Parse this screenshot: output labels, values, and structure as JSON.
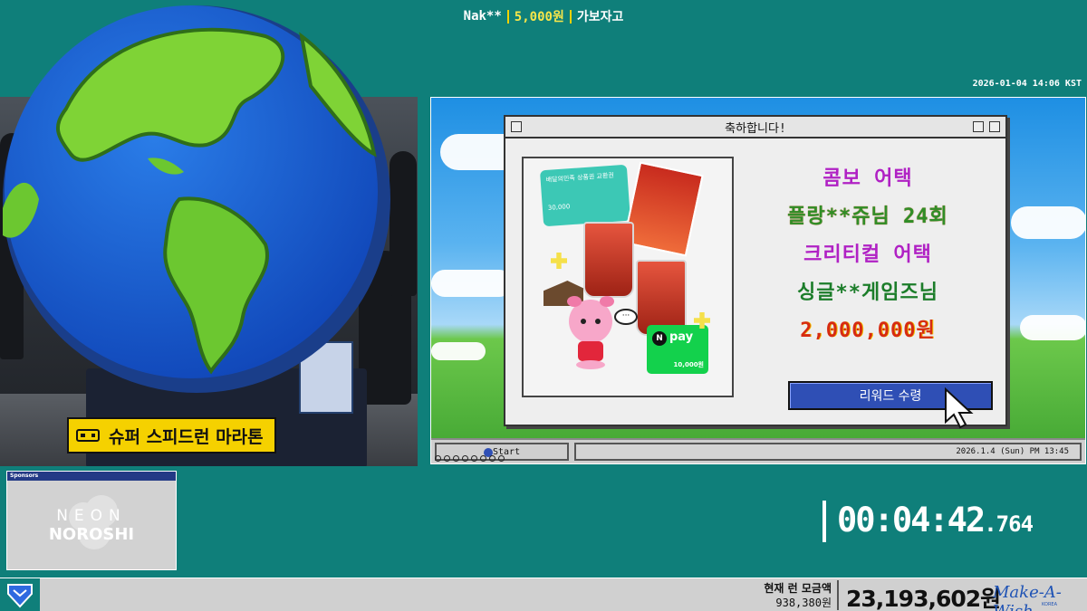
{
  "overlay": {
    "donation": {
      "user": "Nak**",
      "amount": "5,000원",
      "message": "가보자고"
    },
    "datetime": "2026-01-04 14:06 KST",
    "camera_badge": "슈퍼 스피드런 마라톤",
    "timer": {
      "main": "00:04:42",
      "ms": ".764"
    },
    "sponsor": {
      "title": "Sponsors",
      "line1": "NEON",
      "line2": "NOROSHI"
    },
    "bottom": {
      "current_run_label": "현재 런 모금액",
      "current_run_value": "938,380원",
      "total": "23,193,602원",
      "charity": "Make-A-Wish",
      "charity_sub": "KOREA"
    }
  },
  "window": {
    "title": "축하합니다!",
    "lines": [
      "콤보 어택",
      "플랑**쥬님 24회",
      "크리티컬 어택",
      "싱글**게임즈님",
      "2,000,000원"
    ],
    "button": "리워드 수령",
    "gift_card_text": "배달의민족 상품권 교환권",
    "gift_card_value": "30,000",
    "npay_label": "pay",
    "npay_value": "10,000원"
  },
  "taskbar": {
    "start": "Start",
    "clock": "2026.1.4 (Sun) PM 13:45"
  },
  "colors": {
    "background": "#0f7f7a",
    "badge": "#f5d100",
    "reward_button": "#2f4fb5",
    "magenta_text": "#b021c4",
    "green_text": "#2f8e27",
    "prize_text": "#d62b12"
  },
  "icons": [
    "globe-icon",
    "gamepad-icon",
    "cursor-icon",
    "start-orb-icon",
    "shield-logo-icon",
    "cloud-logo-icon"
  ]
}
